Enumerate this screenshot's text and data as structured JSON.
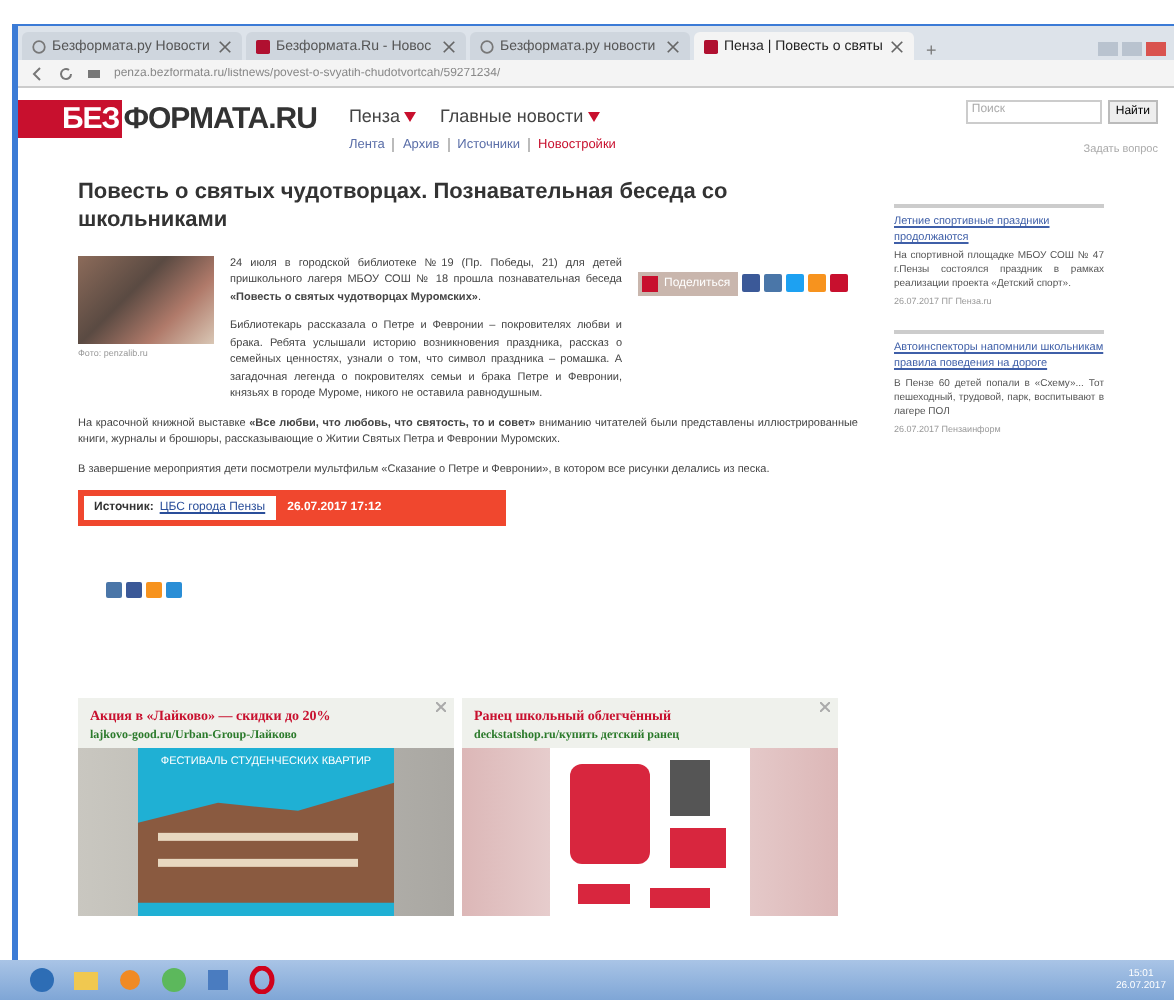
{
  "browser": {
    "tabs": [
      {
        "title": "Безформата.ру Новости",
        "selected": false,
        "kind": "google"
      },
      {
        "title": "Безформата.Ru - Новос",
        "selected": false,
        "kind": "site"
      },
      {
        "title": "Безформата.ру новости",
        "selected": false,
        "kind": "google"
      },
      {
        "title": "Пенза | Повесть о святы",
        "selected": true,
        "kind": "site"
      }
    ],
    "new_tab": "+",
    "url": "penza.bezformata.ru/listnews/povest-o-svyatih-chudotvortcah/59271234/"
  },
  "header": {
    "logo_mark": "БЕЗ",
    "logo_text": "ФОРМАТА.RU",
    "menus": [
      "Пенза",
      "Главные новости"
    ],
    "subnav": [
      {
        "label": "Лента",
        "kind": "link"
      },
      {
        "label": "Архив",
        "kind": "link"
      },
      {
        "label": "Источники",
        "kind": "link"
      },
      {
        "label": "Новостройки",
        "kind": "hot"
      }
    ],
    "search": {
      "placeholder": "Поиск",
      "button": "Найти"
    },
    "extra_link": "Задать вопрос"
  },
  "article": {
    "title": "Повесть о святых чудотворцах. Познавательная беседа со школьниками",
    "photo_caption": "Фото: penzalib.ru",
    "share_label": "Поделиться",
    "paragraphs": [
      "24 июля в городской библиотеке №19 (Пр. Победы, 21) для детей пришкольного лагеря МБОУ СОШ № 18 прошла познавательная беседа **«Повесть о святых чудотворцах Муромских»**.",
      "Библиотекарь рассказала о Петре и Февронии – покровителях любви и брака. Ребята услышали историю возникновения праздника, рассказ о семейных ценностях, узнали о том, что символ праздника – ромашка. А загадочная легенда о покровителях семьи и брака Петре и Февронии, князьях в городе Муроме, никого не оставила равнодушным.",
      "На красочной книжной выставке **«Все любви, что любовь, что святость, то и совет»** вниманию читателей были представлены иллюстрированные книги, журналы и брошюры, рассказывающие о Житии Святых Петра и Февронии Муромских.",
      "В завершение мероприятия дети посмотрели мультфильм «Сказание о Петре и Февронии», в котором все рисунки делались из песка."
    ],
    "source_label": "Источник:",
    "source_link": "ЦБС города Пензы",
    "datetime": "26.07.2017 17:12"
  },
  "sidebar": {
    "items": [
      {
        "title": "Летние спортивные праздники продолжаются",
        "text": "На спортивной площадке МБОУ СОШ № 47 г.Пензы состоялся праздник в рамках реализации проекта «Детский спорт».",
        "meta": "26.07.2017 ПГ Пенза.ru"
      },
      {
        "title": "Автоинспекторы напомнили школьникам правила поведения на дороге",
        "text": "В Пензе 60 детей попали в «Схему»... Тот пешеходный, трудовой, парк, воспитывают в лагере ПОЛ",
        "meta": "26.07.2017 Пензаинформ"
      }
    ]
  },
  "ads": [
    {
      "title": "Акция в «Лайково» — скидки до 20%",
      "url": "lajkovo-good.ru/Urban-Group-Лайково",
      "kind": "building",
      "banner": "ФЕСТИВАЛЬ СТУДЕНЧЕСКИХ КВАРТИР"
    },
    {
      "title": "Ранец школьный облегчённый",
      "url": "deckstatshop.ru/купить детский ранец",
      "kind": "backpack"
    }
  ],
  "taskbar": {
    "time": "15:01",
    "date": "26.07.2017"
  }
}
